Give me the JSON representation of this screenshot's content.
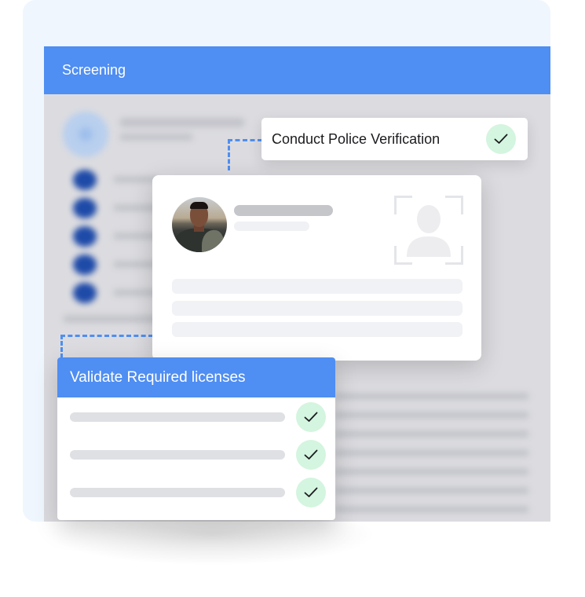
{
  "app": {
    "header_title": "Screening"
  },
  "tasks": {
    "police_verification": {
      "label": "Conduct Police Verification",
      "status": "completed",
      "status_icon": "check-icon"
    },
    "licenses": {
      "title": "Validate Required licenses",
      "items": [
        {
          "status": "completed",
          "status_icon": "check-icon"
        },
        {
          "status": "completed",
          "status_icon": "check-icon"
        },
        {
          "status": "completed",
          "status_icon": "check-icon"
        }
      ]
    }
  },
  "profile_card": {
    "avatar": "person-photo",
    "id_placeholder_icon": "face-scan-icon"
  },
  "colors": {
    "accent_blue": "#4f8ef2",
    "success_badge_bg": "#d4f5df",
    "panel_bg": "#eff6fe",
    "app_bg": "#dcdce0"
  }
}
